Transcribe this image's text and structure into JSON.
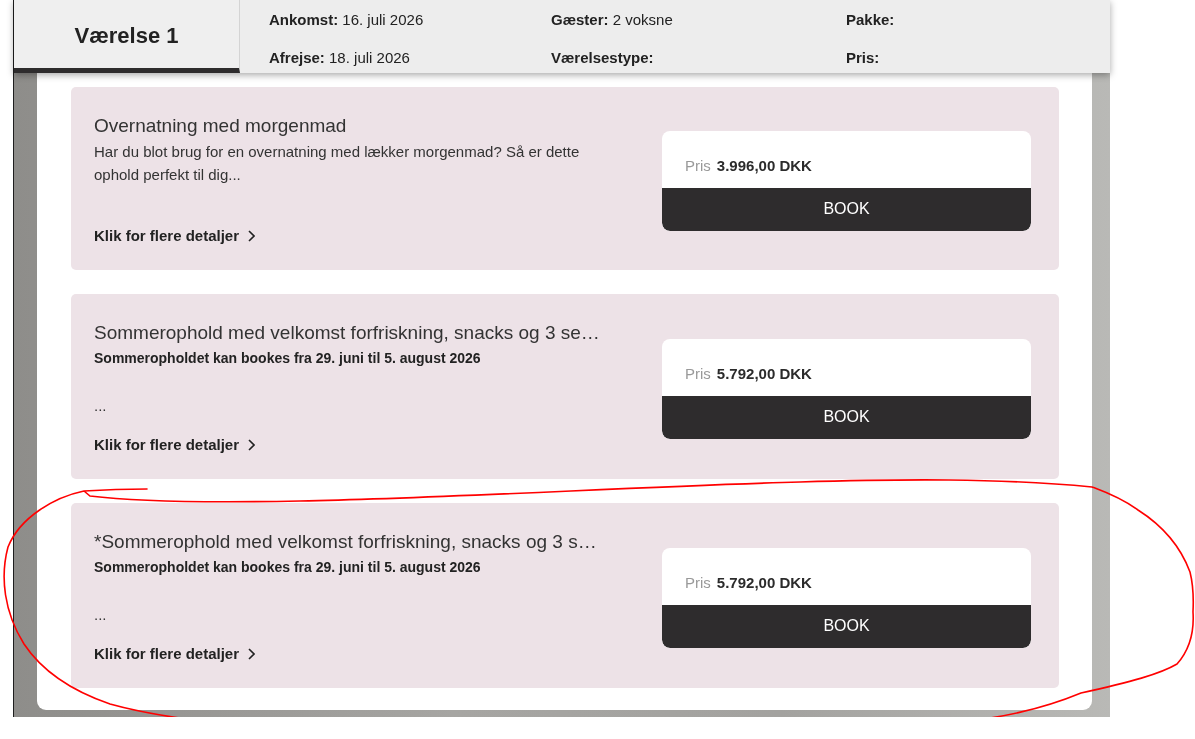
{
  "header": {
    "tab": {
      "label": "Værelse 1",
      "selected": true
    },
    "details": [
      {
        "label": "Ankomst:",
        "value": "16. juli 2026"
      },
      {
        "label": "Gæster:",
        "value": "2 voksne"
      },
      {
        "label": "Pakke:"
      },
      {
        "label": "Afrejse:",
        "value": "18. juli 2026"
      },
      {
        "label": "Værelsestype:"
      },
      {
        "label": "Pris:"
      }
    ]
  },
  "packages": [
    {
      "title": "Overnatning med morgenmad",
      "description": "Har du blot brug for en overnatning med lækker morgenmad? Så er dette ophold perfekt til dig...",
      "details_link": "Klik for flere detaljer",
      "price_label": "Pris",
      "price": "3.996,00 DKK",
      "button": "BOOK",
      "circled": false
    },
    {
      "title": "Sommerophold med velkomst forfriskning, snacks og 3 se…",
      "subtitle": "Sommeropholdet kan bookes fra 29. juni til 5. august 2026",
      "description": "...",
      "details_link": "Klik for flere detaljer",
      "price_label": "Pris",
      "price": "5.792,00 DKK",
      "button": "BOOK",
      "circled": false
    },
    {
      "title": "*Sommerophold med velkomst forfriskning, snacks og 3 s…",
      "subtitle": "Sommeropholdet kan bookes fra 29. juni til 5. august 2026",
      "description": "...",
      "details_link": "Klik for flere detaljer",
      "price_label": "Pris",
      "price": "5.792,00 DKK",
      "button": "BOOK",
      "circled": true
    }
  ]
}
